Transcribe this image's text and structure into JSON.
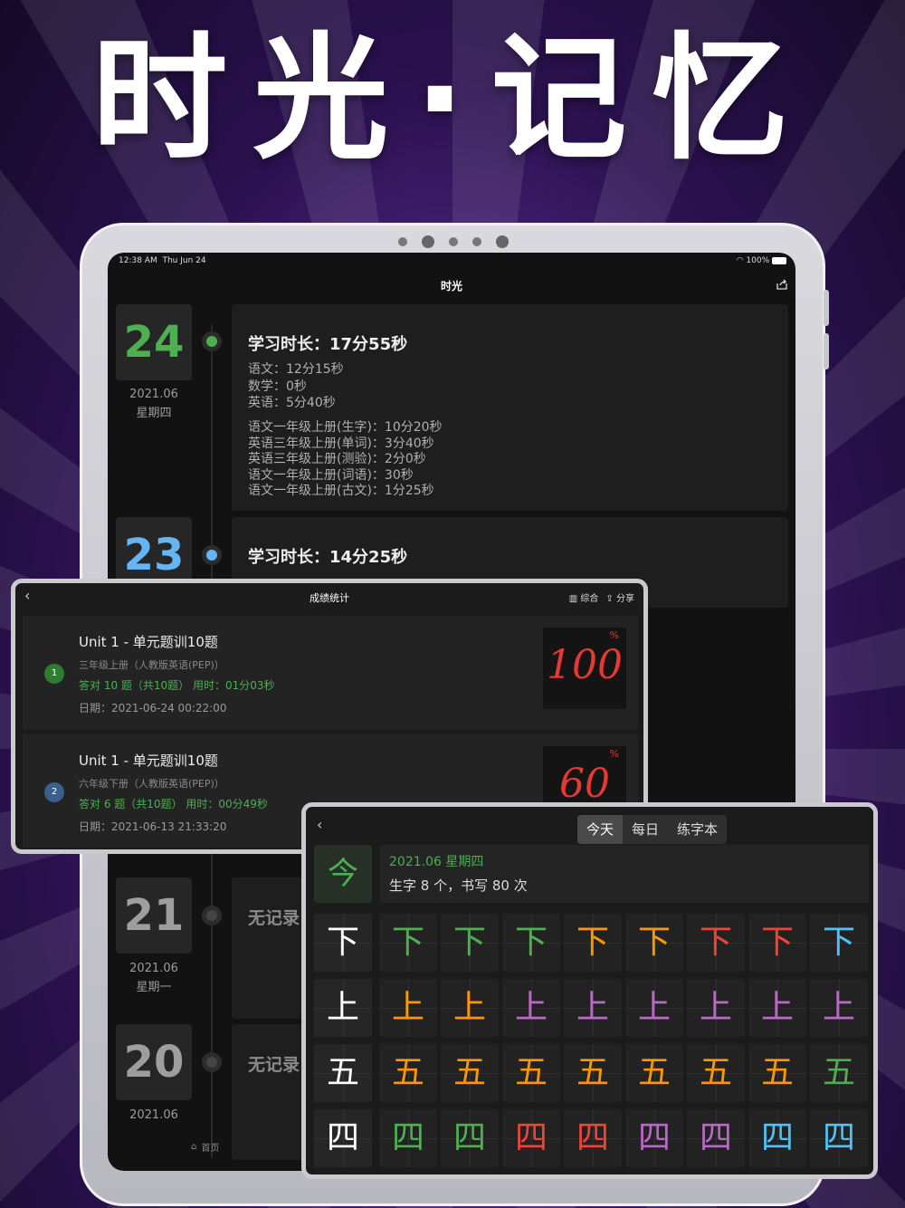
{
  "headline": "时光·记忆",
  "status": {
    "time": "12:38 AM",
    "date": "Thu Jun 24",
    "battery": "100%"
  },
  "nav": {
    "title": "时光",
    "share_icon": "share-icon"
  },
  "days": [
    {
      "day": "24",
      "month": "2021.06",
      "weekday": "星期四",
      "color": "#4caf50",
      "heading": "学习时长：17分55秒",
      "subjects": [
        "语文：12分15秒",
        "数学：0秒",
        "英语：5分40秒"
      ],
      "details": [
        "语文一年级上册(生字)：10分20秒",
        "英语三年级上册(单词)：3分40秒",
        "英语三年级上册(测验)：2分0秒",
        "语文一年级上册(词语)：30秒",
        "语文一年级上册(古文)：1分25秒"
      ]
    },
    {
      "day": "23",
      "color": "#64b5f6",
      "heading": "学习时长：14分25秒"
    },
    {
      "day": "21",
      "month": "2021.06",
      "weekday": "星期一",
      "norecord": "无记录"
    },
    {
      "day": "20",
      "month": "2021.06",
      "norecord": "无记录"
    }
  ],
  "tabbar": {
    "home": "首页"
  },
  "scores": {
    "title": "成绩统计",
    "action_overall": "综合",
    "action_share": "分享",
    "records": [
      {
        "index": "1",
        "index_color": "#2e7d32",
        "title": "Unit 1 - 单元题训10题",
        "book": "三年级上册（人教版英语(PEP)）",
        "result": "答对 10 题（共10题） 用时：01分03秒",
        "date": "日期：2021-06-24 00:22:00",
        "score": "100",
        "pct": "%"
      },
      {
        "index": "2",
        "index_color": "#3a5f8a",
        "title": "Unit 1 - 单元题训10题",
        "book": "六年级下册（人教版英语(PEP)）",
        "result": "答对 6 题（共10题） 用时：00分49秒",
        "date": "日期：2021-06-13 21:33:20",
        "score": "60",
        "pct": "%"
      }
    ]
  },
  "practice": {
    "tabs": [
      "今天",
      "每日",
      "练字本"
    ],
    "today_char": "今",
    "date": "2021.06 星期四",
    "summary": "生字 8 个，书写 80 次",
    "rows": [
      {
        "char": "下",
        "colors": [
          "#4caf50",
          "#4caf50",
          "#4caf50",
          "#ff9800",
          "#ff9800",
          "#f44336",
          "#f44336",
          "#4fc3f7"
        ]
      },
      {
        "char": "上",
        "colors": [
          "#ff9800",
          "#ff9800",
          "#ba68c8",
          "#ba68c8",
          "#ba68c8",
          "#ba68c8",
          "#ba68c8",
          "#ba68c8"
        ]
      },
      {
        "char": "五",
        "colors": [
          "#ff9800",
          "#ff9800",
          "#ff9800",
          "#ff9800",
          "#ff9800",
          "#ff9800",
          "#ff9800",
          "#4caf50"
        ]
      },
      {
        "char": "四",
        "colors": [
          "#4caf50",
          "#4caf50",
          "#f44336",
          "#f44336",
          "#ba68c8",
          "#ba68c8",
          "#4fc3f7",
          "#4fc3f7"
        ]
      }
    ]
  }
}
